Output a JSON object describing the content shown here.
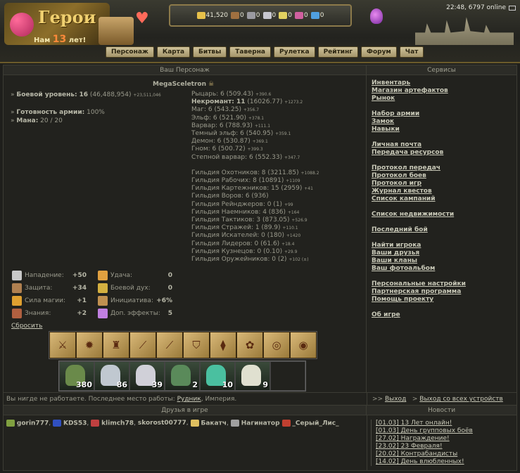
{
  "header": {
    "logo_title": "Герои",
    "logo_sub_prefix": "Нам",
    "logo_sub_num": "13",
    "logo_sub_suffix": "лет!",
    "clock": "22:48, 6797 online",
    "resources": [
      {
        "name": "gold",
        "value": "41,520",
        "color": "#e6c04a"
      },
      {
        "name": "wood",
        "value": "0",
        "color": "#a07040"
      },
      {
        "name": "ore",
        "value": "0",
        "color": "#9a9aa0"
      },
      {
        "name": "mercury",
        "value": "0",
        "color": "#c8c8d0"
      },
      {
        "name": "sulfur",
        "value": "0",
        "color": "#e0d060"
      },
      {
        "name": "crystals",
        "value": "0",
        "color": "#d060a0"
      },
      {
        "name": "gems",
        "value": "0",
        "color": "#50a0e0"
      }
    ]
  },
  "nav": [
    "Персонаж",
    "Карта",
    "Битвы",
    "Таверна",
    "Рулетка",
    "Рейтинг",
    "Форум",
    "Чат"
  ],
  "character": {
    "section_title": "Ваш Персонаж",
    "name": "MegaSceletron",
    "combat_level_label": "Боевой уровень:",
    "combat_level": "16",
    "combat_exp": "(46,488,954)",
    "combat_exp_plus": "+23,511,046",
    "army_ready_label": "Готовность армии:",
    "army_ready": "100%",
    "mana_label": "Мана:",
    "mana": "20 / 20",
    "factions": [
      {
        "text": "Рыцарь: 6 (509.43)",
        "plus": "+390.6",
        "bold": false
      },
      {
        "text": "Некромант: 11",
        "rest": " (16026.77)",
        "plus": "+1273.2",
        "bold": true
      },
      {
        "text": "Маг: 6 (543.25)",
        "plus": "+356.7",
        "bold": false
      },
      {
        "text": "Эльф: 6 (521.90)",
        "plus": "+378.1",
        "bold": false
      },
      {
        "text": "Варвар: 6 (788.93)",
        "plus": "+111.1",
        "bold": false
      },
      {
        "text": "Темный эльф: 6 (540.95)",
        "plus": "+359.1",
        "bold": false
      },
      {
        "text": "Демон: 6 (530.87)",
        "plus": "+369.1",
        "bold": false
      },
      {
        "text": "Гном: 6 (500.72)",
        "plus": "+399.3",
        "bold": false
      },
      {
        "text": "Степной варвар: 6 (552.33)",
        "plus": "+347.7",
        "bold": false
      }
    ],
    "guilds": [
      {
        "text": "Гильдия Охотников: 8 (3211.85)",
        "plus": "+1088.2"
      },
      {
        "text": "Гильдия Рабочих: 8 (10891)",
        "plus": "+1109"
      },
      {
        "text": "Гильдия Картежников: 15 (2959)",
        "plus": "+41"
      },
      {
        "text": "Гильдия Воров: 6 (936)",
        "plus": ""
      },
      {
        "text": "Гильдия Рейнджеров: 0 (1)",
        "plus": "+99"
      },
      {
        "text": "Гильдия Наемников: 4 (836)",
        "plus": "+164"
      },
      {
        "text": "Гильдия Тактиков: 3 (873.05)",
        "plus": "+526.9"
      },
      {
        "text": "Гильдия Стражей: 1 (89.9)",
        "plus": "+110.1"
      },
      {
        "text": "Гильдия Искателей: 0 (180)",
        "plus": "+1420"
      },
      {
        "text": "Гильдия Лидеров: 0 (61.6)",
        "plus": "+18.4"
      },
      {
        "text": "Гильдия Кузнецов: 0 (0.10)",
        "plus": "+29.9"
      },
      {
        "text": "Гильдия Оружейников: 0 (2)",
        "plus": "+102 (±)"
      }
    ],
    "attributes": [
      {
        "label": "Нападение:",
        "value": "+50",
        "icon": "swords-icon",
        "color": "#c8c8c8"
      },
      {
        "label": "Удача:",
        "value": "0",
        "icon": "rainbow-icon",
        "color": "#e0a040"
      },
      {
        "label": "Защита:",
        "value": "+34",
        "icon": "shield-icon",
        "color": "#b08050"
      },
      {
        "label": "Боевой дух:",
        "value": "0",
        "icon": "wings-icon",
        "color": "#d4b040"
      },
      {
        "label": "Сила магии:",
        "value": "+1",
        "icon": "wand-icon",
        "color": "#e0a030"
      },
      {
        "label": "Инициатива:",
        "value": "+6%",
        "icon": "hourglass-icon",
        "color": "#c09050"
      },
      {
        "label": "Знания:",
        "value": "+2",
        "icon": "book-icon",
        "color": "#b06040"
      },
      {
        "label": "Доп. эффекты:",
        "value": "5",
        "icon": "orb-icon",
        "color": "#c080e0"
      }
    ],
    "reset": "Сбросить",
    "army": [
      {
        "count": "380",
        "color": "#6a8a4a"
      },
      {
        "count": "86",
        "color": "#c0c8d0"
      },
      {
        "count": "39",
        "color": "#d0d0d8"
      },
      {
        "count": "2",
        "color": "#5a8a5a"
      },
      {
        "count": "10",
        "color": "#4ac0a0"
      },
      {
        "count": "9",
        "color": "#e0e0d0"
      },
      {
        "count": "",
        "color": ""
      }
    ],
    "equipment": [
      "⚔",
      "✹",
      "♜",
      "⟋",
      "⟋",
      "⛉",
      "⧫",
      "✿",
      "◎",
      "◉"
    ]
  },
  "work": {
    "text": "Вы нигде не работаете. Последнее место работы:",
    "place": "Рудник",
    "suffix": ", Империя."
  },
  "logout": {
    "exit": "Выход",
    "exit_all": "Выход со всех устройств"
  },
  "services": {
    "title": "Сервисы",
    "groups": [
      [
        "Инвентарь",
        "Магазин артефактов",
        "Рынок"
      ],
      [
        "Набор армии",
        "Замок",
        "Навыки"
      ],
      [
        "Личная почта",
        "Передача ресурсов"
      ],
      [
        "Протокол передач",
        "Протокол боев",
        "Протокол игр",
        "Журнал квестов",
        "Список кампаний"
      ],
      [
        "Список недвижимости"
      ],
      [
        "Последний бой"
      ],
      [
        "Найти игрока",
        "Ваши друзья",
        "Ваши кланы",
        "Ваш фотоальбом"
      ],
      [
        "Персональные настройки",
        "Партнерская программа",
        "Помощь проекту"
      ],
      [
        "Об игре"
      ]
    ]
  },
  "friends": {
    "title": "Друзья в игре",
    "list": [
      {
        "name": "gorin777",
        "color": "#80a040"
      },
      {
        "name": "KDS53",
        "color": "#3050c0"
      },
      {
        "name": "klimch78",
        "color": "#c04040"
      },
      {
        "name": "skorost00777",
        "color": ""
      },
      {
        "name": "Бакатч",
        "color": "#e0c060"
      },
      {
        "name": "Нагинатор",
        "color": "#a0a0a0"
      },
      {
        "name": "_Серый_Лис_",
        "color": "#c04030"
      }
    ]
  },
  "news": {
    "title": "Новости",
    "items": [
      "[01.03] 13 Лет онлайн!",
      "[01.03] День групповых боёв",
      "[27.02] Награждение!",
      "[23.02] 23 Февраля!",
      "[20.02] Контрабандисты",
      "[14.02] День влюбленных!"
    ]
  }
}
